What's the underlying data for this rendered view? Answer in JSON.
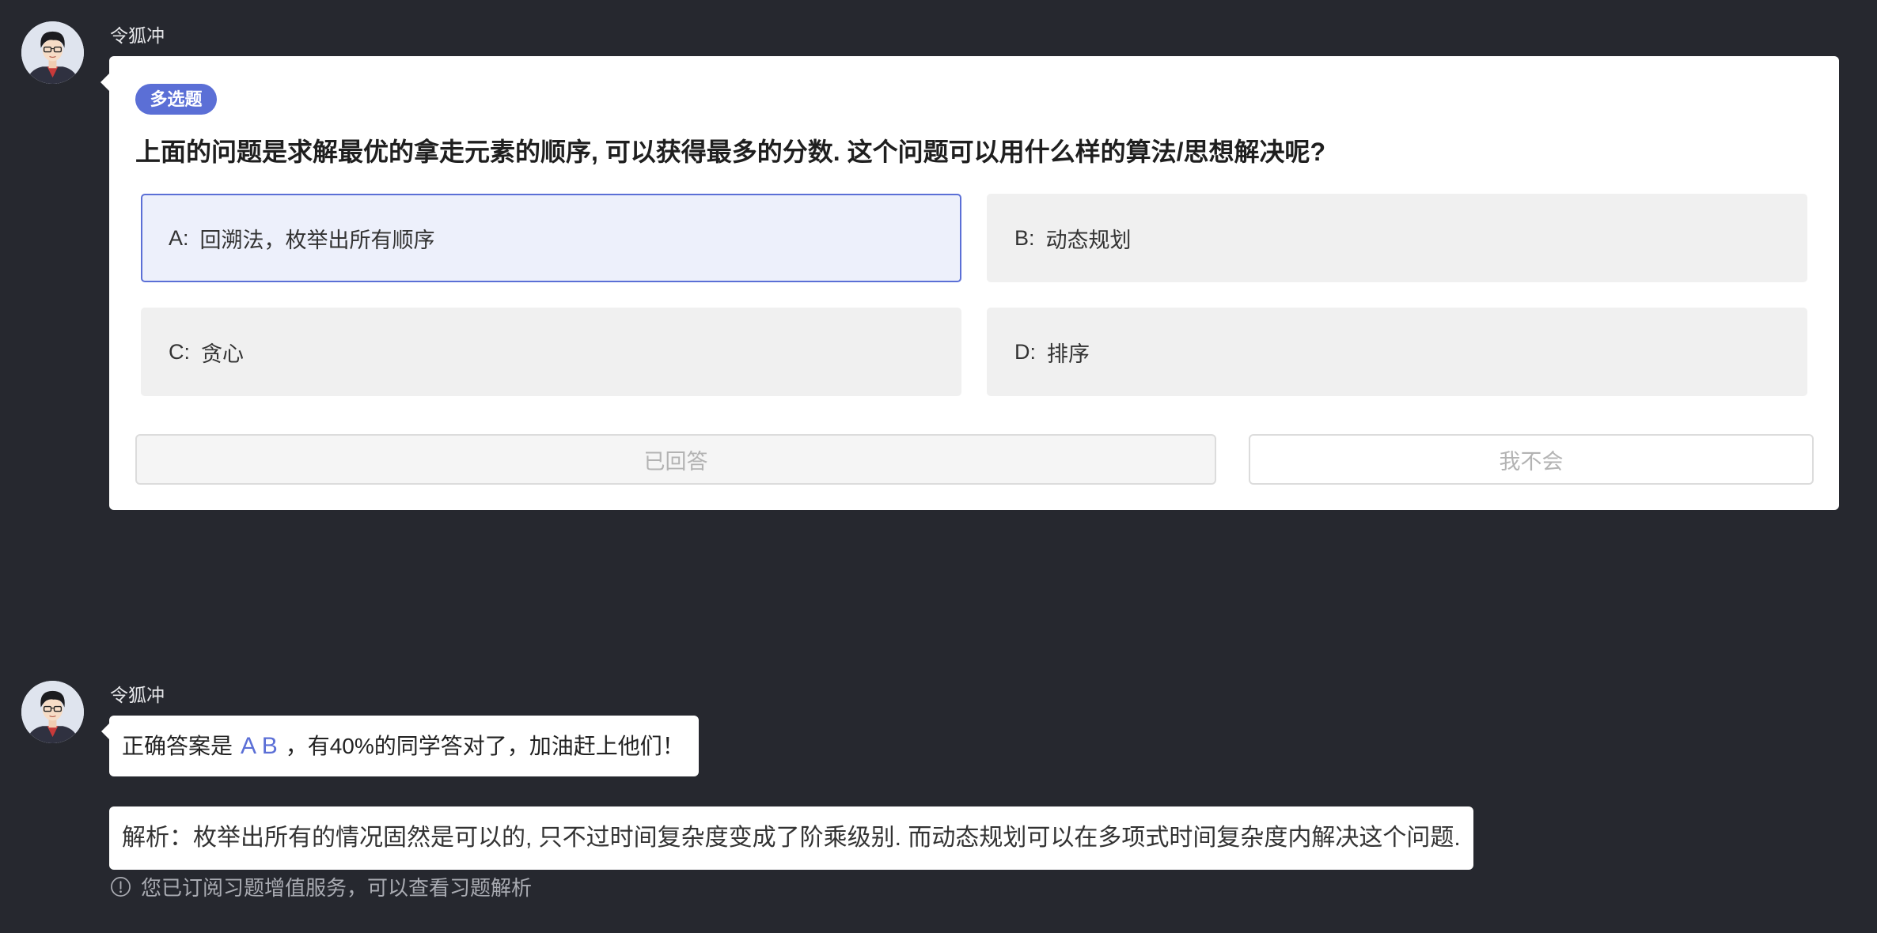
{
  "theme": {
    "background": "#26282f",
    "accent": "#5b6fd6",
    "selected_bg": "#edf0fb",
    "option_bg": "#f0f0f0",
    "muted_text": "#b3b3b3"
  },
  "question_message": {
    "sender": "令狐冲",
    "avatar": "avatar-boy-glasses-icon",
    "tag": "多选题",
    "question": "上面的问题是求解最优的拿走元素的顺序, 可以获得最多的分数. 这个问题可以用什么样的算法/思想解决呢?",
    "options": [
      {
        "key": "A:",
        "label": "回溯法，枚举出所有顺序",
        "selected": true
      },
      {
        "key": "B:",
        "label": "动态规划",
        "selected": false
      },
      {
        "key": "C:",
        "label": "贪心",
        "selected": false
      },
      {
        "key": "D:",
        "label": "排序",
        "selected": false
      }
    ],
    "buttons": {
      "answered": "已回答",
      "dont_know": "我不会"
    }
  },
  "result_message": {
    "sender": "令狐冲",
    "avatar": "avatar-boy-glasses-icon",
    "answer_prefix": "正确答案是",
    "answer": "A B",
    "answer_suffix": "，有40%的同学答对了，加油赶上他们！",
    "analysis_label": "解析：",
    "analysis": "枚举出所有的情况固然是可以的, 只不过时间复杂度变成了阶乘级别. 而动态规划可以在多项式时间复杂度内解决这个问题.",
    "notice_icon": "exclamation-circle-icon",
    "notice": "您已订阅习题增值服务，可以查看习题解析"
  }
}
